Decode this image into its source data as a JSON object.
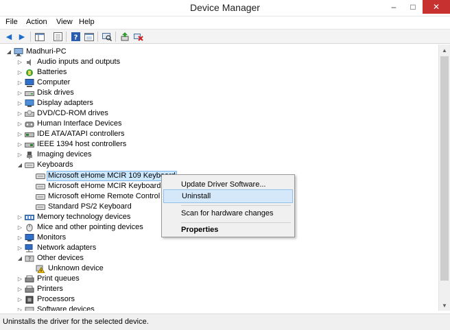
{
  "window": {
    "title": "Device Manager"
  },
  "menu": [
    "File",
    "Action",
    "View",
    "Help"
  ],
  "tree": {
    "root": "Madhuri-PC",
    "items": [
      {
        "label": "Audio inputs and outputs",
        "icon": "speaker-icon"
      },
      {
        "label": "Batteries",
        "icon": "battery-icon"
      },
      {
        "label": "Computer",
        "icon": "computer-icon"
      },
      {
        "label": "Disk drives",
        "icon": "disk-drive-icon"
      },
      {
        "label": "Display adapters",
        "icon": "display-adapter-icon"
      },
      {
        "label": "DVD/CD-ROM drives",
        "icon": "dvd-drive-icon"
      },
      {
        "label": "Human Interface Devices",
        "icon": "hid-icon"
      },
      {
        "label": "IDE ATA/ATAPI controllers",
        "icon": "ide-controller-icon"
      },
      {
        "label": "IEEE 1394 host controllers",
        "icon": "ieee1394-icon"
      },
      {
        "label": "Imaging devices",
        "icon": "camera-icon"
      },
      {
        "label": "Keyboards",
        "icon": "keyboard-icon",
        "expanded": true,
        "children": [
          {
            "label": "Microsoft eHome MCIR 109 Keyboard",
            "selected": true
          },
          {
            "label": "Microsoft eHome MCIR Keyboard"
          },
          {
            "label": "Microsoft eHome Remote Control Ke"
          },
          {
            "label": "Standard PS/2 Keyboard"
          }
        ]
      },
      {
        "label": "Memory technology devices",
        "icon": "memory-icon"
      },
      {
        "label": "Mice and other pointing devices",
        "icon": "mouse-icon"
      },
      {
        "label": "Monitors",
        "icon": "monitor-icon"
      },
      {
        "label": "Network adapters",
        "icon": "network-adapter-icon"
      },
      {
        "label": "Other devices",
        "icon": "other-devices-icon",
        "expanded": true,
        "children": [
          {
            "label": "Unknown device",
            "icon": "warning-icon"
          }
        ]
      },
      {
        "label": "Print queues",
        "icon": "print-queue-icon"
      },
      {
        "label": "Printers",
        "icon": "printer-icon"
      },
      {
        "label": "Processors",
        "icon": "processor-icon"
      },
      {
        "label": "Software devices",
        "icon": "software-device-icon"
      }
    ]
  },
  "context_menu": {
    "items": [
      "Update Driver Software...",
      "Uninstall",
      "Scan for hardware changes",
      "Properties"
    ],
    "highlighted": "Uninstall"
  },
  "status": {
    "text": "Uninstalls the driver for the selected device."
  },
  "colors": {
    "selection": "#cce8ff",
    "menu_highlight": "#d4e8f9",
    "close_button": "#c7312f"
  }
}
